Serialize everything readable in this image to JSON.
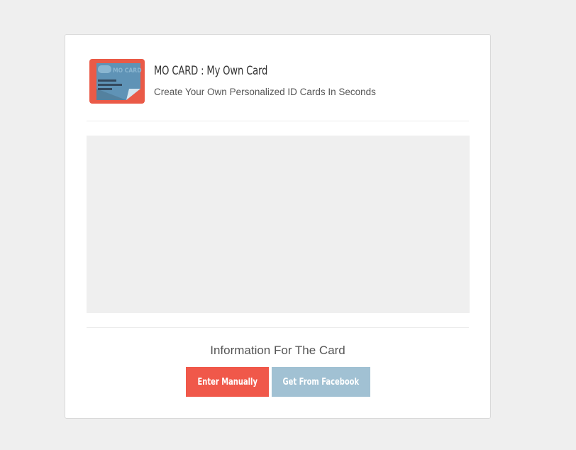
{
  "app": {
    "title": "MO CARD : My Own Card",
    "subtitle": "Create Your Own Personalized ID Cards In Seconds",
    "logo_text": "MO CARD"
  },
  "info": {
    "heading": "Information For The Card"
  },
  "buttons": {
    "manual_label": "Enter Manually",
    "facebook_label": "Get From Facebook"
  },
  "colors": {
    "manual_bg": "#f0584a",
    "facebook_bg": "#a1c1d3",
    "logo_red": "#ea5a47",
    "logo_card": "#5f93b6"
  }
}
